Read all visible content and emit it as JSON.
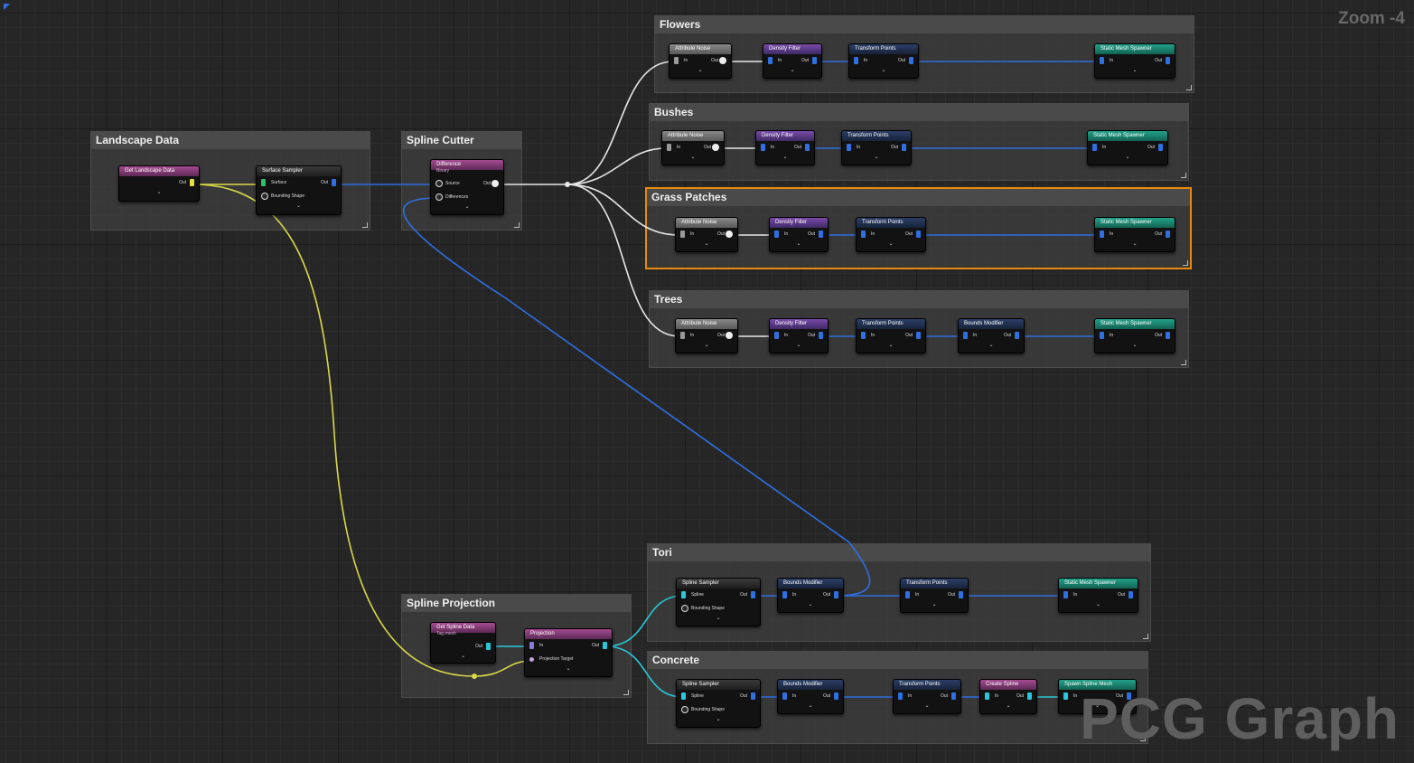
{
  "zoom_label": "Zoom -4",
  "watermark": "PCG Graph",
  "colors": {
    "point_wire": "#2f6fe0",
    "landscape_wire": "#d9d84a",
    "spline_wire": "#29c7d9",
    "param_wire": "#e8e8e8",
    "selection": "#e88a0b"
  },
  "groups": [
    {
      "id": "landscape",
      "title": "Landscape Data",
      "nodes": [
        {
          "title": "Get Landscape Data",
          "style": "pink",
          "pins": [
            {
              "out": "Out",
              "out_pin": "yellow"
            }
          ]
        },
        {
          "title": "Surface Sampler",
          "style": "dark",
          "pins": [
            {
              "in": "Surface",
              "in_pin": "green",
              "out": "Out",
              "out_pin": "blue"
            },
            {
              "in": "Bounding Shape",
              "in_pin": "shape"
            }
          ]
        }
      ]
    },
    {
      "id": "spline_cutter",
      "title": "Spline Cutter",
      "nodes": [
        {
          "title": "Difference",
          "subtitle": "Binary",
          "style": "pink",
          "pins": [
            {
              "in": "Source",
              "in_pin": "shape",
              "out": "Out",
              "out_pin": "white"
            },
            {
              "in": "Differences",
              "in_pin": "shape"
            }
          ]
        }
      ]
    },
    {
      "id": "flowers",
      "title": "Flowers",
      "nodes": [
        {
          "title": "Attribute Noise",
          "style": "gray",
          "pins": [
            {
              "in": "In",
              "in_pin": "gray",
              "out": "Out",
              "out_pin": "white"
            }
          ]
        },
        {
          "title": "Density Filter",
          "style": "purple",
          "pins": [
            {
              "in": "In",
              "in_pin": "blue",
              "out": "Out",
              "out_pin": "blue"
            }
          ]
        },
        {
          "title": "Transform Points",
          "style": "navy",
          "pins": [
            {
              "in": "In",
              "in_pin": "blue",
              "out": "Out",
              "out_pin": "blue"
            }
          ]
        },
        {
          "title": "Static Mesh Spawner",
          "style": "teal",
          "pins": [
            {
              "in": "In",
              "in_pin": "blue",
              "out": "Out",
              "out_pin": "blue"
            }
          ]
        }
      ]
    },
    {
      "id": "bushes",
      "title": "Bushes",
      "nodes": [
        {
          "title": "Attribute Noise",
          "style": "gray",
          "pins": [
            {
              "in": "In",
              "in_pin": "gray",
              "out": "Out",
              "out_pin": "white"
            }
          ]
        },
        {
          "title": "Density Filter",
          "style": "purple",
          "pins": [
            {
              "in": "In",
              "in_pin": "blue",
              "out": "Out",
              "out_pin": "blue"
            }
          ]
        },
        {
          "title": "Transform Points",
          "style": "navy",
          "pins": [
            {
              "in": "In",
              "in_pin": "blue",
              "out": "Out",
              "out_pin": "blue"
            }
          ]
        },
        {
          "title": "Static Mesh Spawner",
          "style": "teal",
          "pins": [
            {
              "in": "In",
              "in_pin": "blue",
              "out": "Out",
              "out_pin": "blue"
            }
          ]
        }
      ]
    },
    {
      "id": "grass",
      "title": "Grass Patches",
      "selected": true,
      "nodes": [
        {
          "title": "Attribute Noise",
          "style": "gray",
          "pins": [
            {
              "in": "In",
              "in_pin": "gray",
              "out": "Out",
              "out_pin": "white"
            }
          ]
        },
        {
          "title": "Density Filter",
          "style": "purple",
          "pins": [
            {
              "in": "In",
              "in_pin": "blue",
              "out": "Out",
              "out_pin": "blue"
            }
          ]
        },
        {
          "title": "Transform Points",
          "style": "navy",
          "pins": [
            {
              "in": "In",
              "in_pin": "blue",
              "out": "Out",
              "out_pin": "blue"
            }
          ]
        },
        {
          "title": "Static Mesh Spawner",
          "style": "teal",
          "pins": [
            {
              "in": "In",
              "in_pin": "blue",
              "out": "Out",
              "out_pin": "blue"
            }
          ]
        }
      ]
    },
    {
      "id": "trees",
      "title": "Trees",
      "nodes": [
        {
          "title": "Attribute Noise",
          "style": "gray",
          "pins": [
            {
              "in": "In",
              "in_pin": "gray",
              "out": "Out",
              "out_pin": "white"
            }
          ]
        },
        {
          "title": "Density Filter",
          "style": "purple",
          "pins": [
            {
              "in": "In",
              "in_pin": "blue",
              "out": "Out",
              "out_pin": "blue"
            }
          ]
        },
        {
          "title": "Transform Points",
          "style": "navy",
          "pins": [
            {
              "in": "In",
              "in_pin": "blue",
              "out": "Out",
              "out_pin": "blue"
            }
          ]
        },
        {
          "title": "Bounds Modifier",
          "style": "navy",
          "pins": [
            {
              "in": "In",
              "in_pin": "blue",
              "out": "Out",
              "out_pin": "blue"
            }
          ]
        },
        {
          "title": "Static Mesh Spawner",
          "style": "teal",
          "pins": [
            {
              "in": "In",
              "in_pin": "blue",
              "out": "Out",
              "out_pin": "blue"
            }
          ]
        }
      ]
    },
    {
      "id": "spline_projection",
      "title": "Spline Projection",
      "nodes": [
        {
          "title": "Get Spline Data",
          "subtitle": "Tag.mesh",
          "style": "pink",
          "pins": [
            {
              "out": "Out",
              "out_pin": "cyan"
            }
          ]
        },
        {
          "title": "Projection",
          "style": "pink",
          "pins": [
            {
              "in": "In",
              "in_pin": "purpleish",
              "out": "Out",
              "out_pin": "cyan"
            },
            {
              "in": "Projection Target",
              "in_pin": "dot"
            }
          ]
        }
      ]
    },
    {
      "id": "tori",
      "title": "Tori",
      "nodes": [
        {
          "title": "Spline Sampler",
          "style": "dark",
          "pins": [
            {
              "in": "Spline",
              "in_pin": "cyan",
              "out": "Out",
              "out_pin": "blue"
            },
            {
              "in": "Bounding Shape",
              "in_pin": "shape"
            }
          ]
        },
        {
          "title": "Bounds Modifier",
          "style": "navy",
          "pins": [
            {
              "in": "In",
              "in_pin": "blue",
              "out": "Out",
              "out_pin": "blue"
            }
          ]
        },
        {
          "title": "Transform Points",
          "style": "navy",
          "pins": [
            {
              "in": "In",
              "in_pin": "blue",
              "out": "Out",
              "out_pin": "blue"
            }
          ]
        },
        {
          "title": "Static Mesh Spawner",
          "style": "teal",
          "pins": [
            {
              "in": "In",
              "in_pin": "blue",
              "out": "Out",
              "out_pin": "blue"
            }
          ]
        }
      ]
    },
    {
      "id": "concrete",
      "title": "Concrete",
      "nodes": [
        {
          "title": "Spline Sampler",
          "style": "dark",
          "pins": [
            {
              "in": "Spline",
              "in_pin": "cyan",
              "out": "Out",
              "out_pin": "blue"
            },
            {
              "in": "Bounding Shape",
              "in_pin": "shape"
            }
          ]
        },
        {
          "title": "Bounds Modifier",
          "style": "navy",
          "pins": [
            {
              "in": "In",
              "in_pin": "blue",
              "out": "Out",
              "out_pin": "blue"
            }
          ]
        },
        {
          "title": "Transform Points",
          "style": "navy",
          "pins": [
            {
              "in": "In",
              "in_pin": "blue",
              "out": "Out",
              "out_pin": "blue"
            }
          ]
        },
        {
          "title": "Create Spline",
          "style": "pink",
          "pins": [
            {
              "in": "In",
              "in_pin": "cyan",
              "out": "Out",
              "out_pin": "cyan"
            }
          ]
        },
        {
          "title": "Spawn Spline Mesh",
          "style": "teal",
          "pins": [
            {
              "in": "In",
              "in_pin": "cyan",
              "out": "Out",
              "out_pin": "blue"
            }
          ]
        }
      ]
    }
  ]
}
